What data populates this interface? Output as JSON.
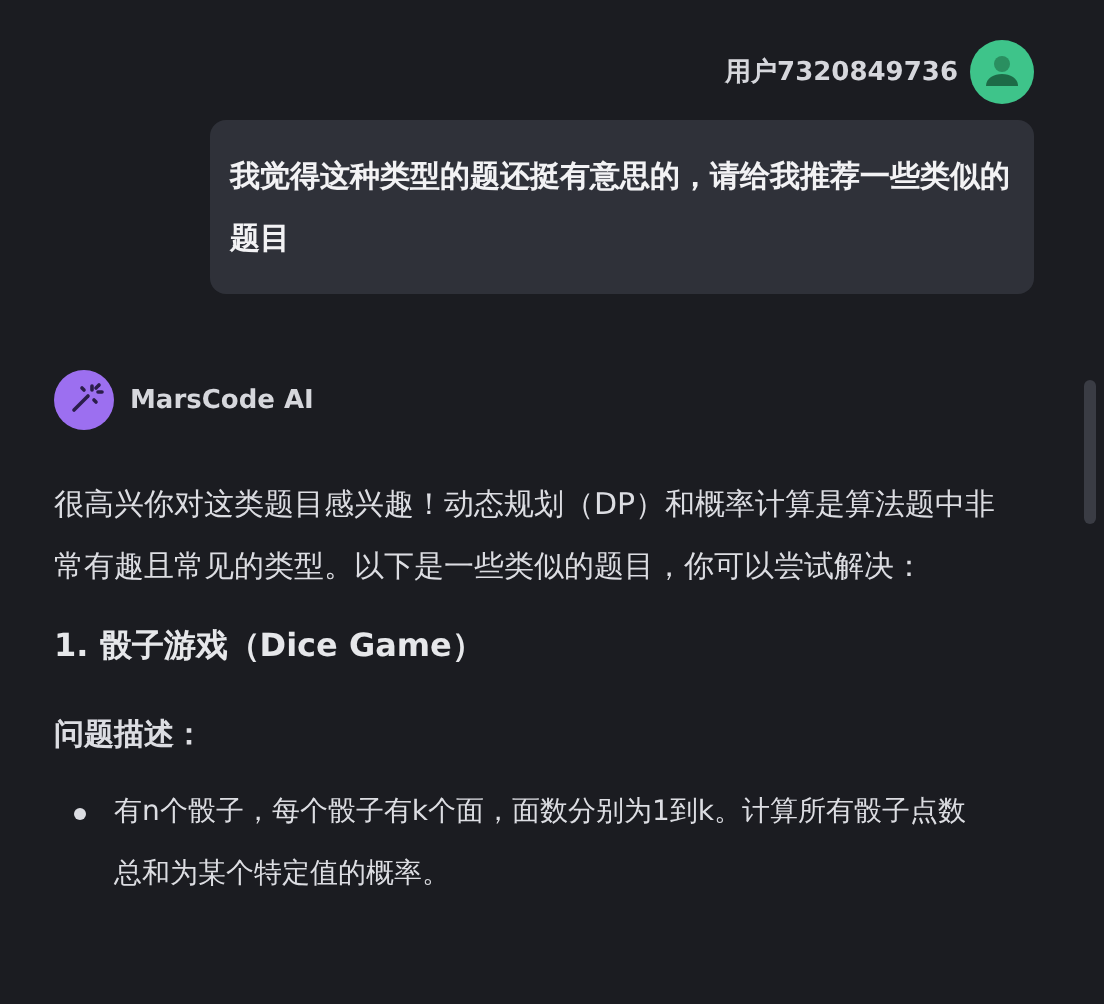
{
  "user_message": {
    "username": "用户7320849736",
    "text": "我觉得这种类型的题还挺有意思的，请给我推荐一些类似的题目"
  },
  "ai_message": {
    "name": "MarsCode AI",
    "intro": "很高兴你对这类题目感兴趣！动态规划（DP）和概率计算是算法题中非常有趣且常见的类型。以下是一些类似的题目，你可以尝试解决：",
    "sections": [
      {
        "heading": "1. 骰子游戏（Dice Game）",
        "subheading": "问题描述：",
        "bullets": [
          "有n个骰子，每个骰子有k个面，面数分别为1到k。计算所有骰子点数总和为某个特定值的概率。"
        ]
      }
    ]
  }
}
